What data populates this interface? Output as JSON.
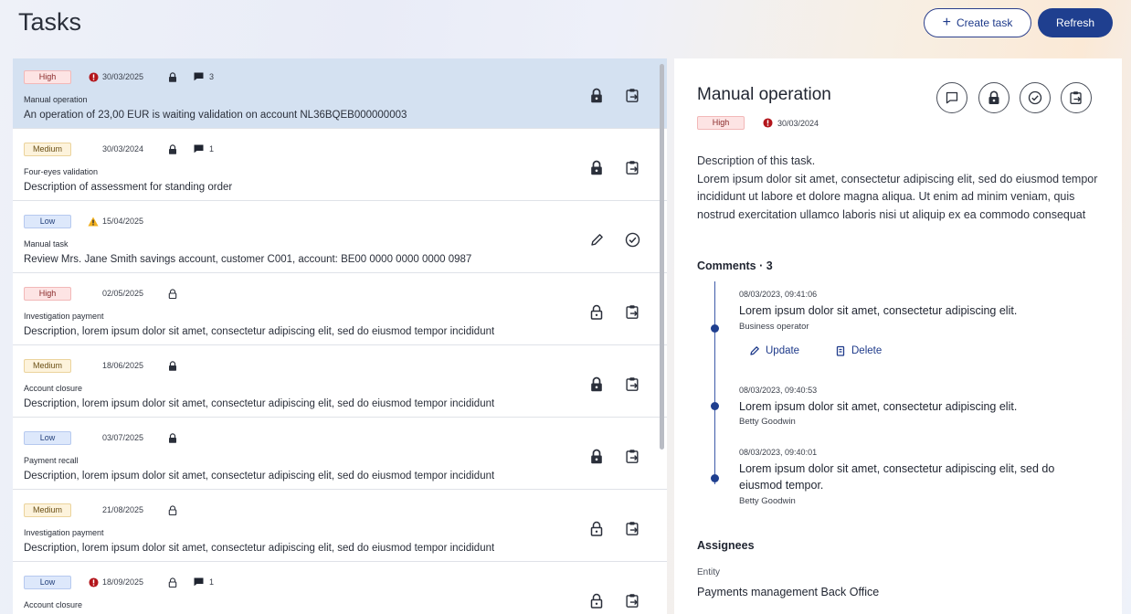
{
  "header": {
    "title": "Tasks",
    "create_label": "Create task",
    "refresh_label": "Refresh"
  },
  "colors": {
    "primary": "#1f3f8f",
    "selected_row": "#d4e1f1",
    "error_icon": "#b3151b",
    "warning_icon": "#f2b01e"
  },
  "tasks": [
    {
      "priority": "High",
      "level": "high",
      "alert": "error",
      "date": "30/03/2025",
      "lock": "closed",
      "comments": "3",
      "title": "Manual operation",
      "description": "An operation of 23,00 EUR is waiting validation on account NL36BQEB000000003",
      "actions": [
        "lock",
        "assign"
      ],
      "selected": true
    },
    {
      "priority": "Medium",
      "level": "medium",
      "alert": "",
      "date": "30/03/2024",
      "lock": "closed",
      "comments": "1",
      "title": "Four-eyes validation",
      "description": "Description of assessment for standing order",
      "actions": [
        "lock",
        "assign"
      ],
      "selected": false
    },
    {
      "priority": "Low",
      "level": "low",
      "alert": "warning",
      "date": "15/04/2025",
      "lock": "",
      "comments": "",
      "title": "Manual task",
      "description": "Review Mrs. Jane Smith savings account, customer C001, account: BE00 0000 0000 0000 0987",
      "actions": [
        "edit",
        "check"
      ],
      "selected": false
    },
    {
      "priority": "High",
      "level": "high",
      "alert": "",
      "date": "02/05/2025",
      "lock": "open",
      "comments": "",
      "title": "Investigation payment",
      "description": "Description, lorem ipsum dolor sit amet, consectetur adipiscing elit, sed do eiusmod tempor incididunt",
      "actions": [
        "unlock",
        "assign"
      ],
      "selected": false
    },
    {
      "priority": "Medium",
      "level": "medium",
      "alert": "",
      "date": "18/06/2025",
      "lock": "closed",
      "comments": "",
      "title": "Account closure",
      "description": "Description, lorem ipsum dolor sit amet, consectetur adipiscing elit, sed do eiusmod tempor incididunt",
      "actions": [
        "lock",
        "assign"
      ],
      "selected": false
    },
    {
      "priority": "Low",
      "level": "low",
      "alert": "",
      "date": "03/07/2025",
      "lock": "closed",
      "comments": "",
      "title": "Payment recall",
      "description": "Description, lorem ipsum dolor sit amet, consectetur adipiscing elit, sed do eiusmod tempor incididunt",
      "actions": [
        "lock",
        "assign"
      ],
      "selected": false
    },
    {
      "priority": "Medium",
      "level": "medium",
      "alert": "",
      "date": "21/08/2025",
      "lock": "open",
      "comments": "",
      "title": "Investigation payment",
      "description": "Description, lorem ipsum dolor sit amet, consectetur adipiscing elit, sed do eiusmod tempor incididunt",
      "actions": [
        "unlock",
        "assign"
      ],
      "selected": false
    },
    {
      "priority": "Low",
      "level": "low",
      "alert": "error",
      "date": "18/09/2025",
      "lock": "open",
      "comments": "1",
      "title": "Account closure",
      "description": "",
      "actions": [
        "unlock",
        "assign"
      ],
      "selected": false
    }
  ],
  "detail": {
    "title": "Manual operation",
    "priority": "High",
    "date": "30/03/2024",
    "description": "Description of this task.\nLorem ipsum dolor sit amet, consectetur adipiscing elit, sed do eiusmod tempor incididunt ut labore et dolore magna aliqua. Ut enim ad minim veniam, quis nostrud exercitation ullamco laboris nisi ut aliquip ex ea commodo consequat",
    "comments_heading": "Comments · 3",
    "comments": [
      {
        "date": "08/03/2023, 09:41:06",
        "text": "Lorem ipsum dolor sit amet, consectetur adipiscing elit.",
        "author": "Business operator"
      },
      {
        "date": "08/03/2023, 09:40:53",
        "text": "Lorem ipsum dolor sit amet, consectetur adipiscing elit.",
        "author": "Betty Goodwin"
      },
      {
        "date": "08/03/2023, 09:40:01",
        "text": "Lorem ipsum dolor sit amet, consectetur adipiscing elit, sed do eiusmod tempor.",
        "author": "Betty Goodwin"
      }
    ],
    "update_label": "Update",
    "delete_label": "Delete",
    "assignees_heading": "Assignees",
    "entity_label": "Entity",
    "entity_value": "Payments management Back Office"
  }
}
